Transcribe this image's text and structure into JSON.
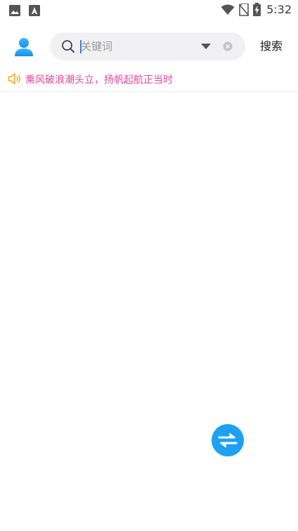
{
  "status_bar": {
    "time": "5:32",
    "icons": [
      "image-icon",
      "a-box-icon",
      "wifi-icon",
      "no-sim-icon",
      "battery-charging-icon"
    ]
  },
  "header": {
    "avatar_icon": "user-icon",
    "search": {
      "placeholder": "关键词",
      "value": "",
      "search_icon": "search-icon",
      "dropdown_icon": "dropdown-arrow-icon",
      "clear_icon": "clear-icon"
    },
    "search_button_label": "搜索"
  },
  "notice": {
    "icon": "speaker-icon",
    "text": "乘风破浪潮头立，扬帆起航正当时"
  },
  "fab": {
    "icon": "swap-icon"
  },
  "colors": {
    "accent": "#1da1f2",
    "notice_text": "#e8439a",
    "speaker": "#f5a623",
    "search_bg": "#f1f1f3"
  }
}
